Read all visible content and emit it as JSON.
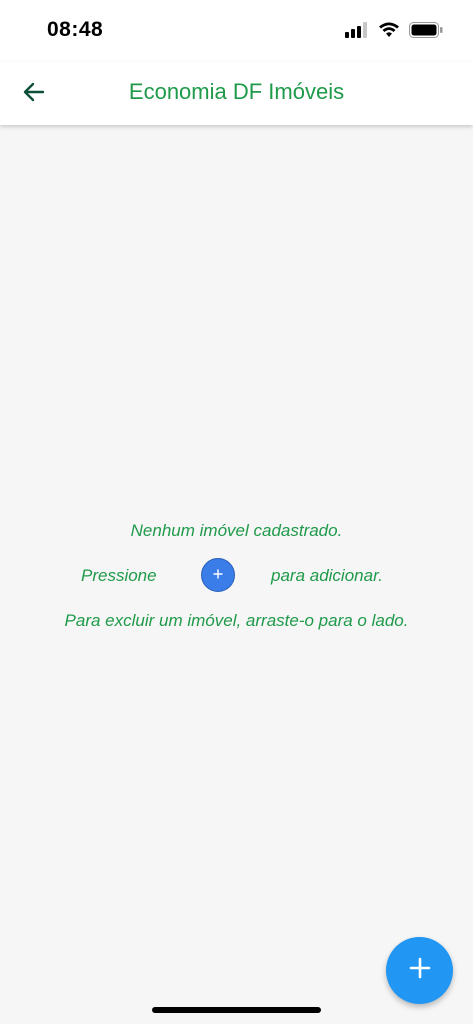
{
  "status_bar": {
    "time": "08:48",
    "icons": [
      "signal-icon",
      "wifi-icon",
      "battery-icon"
    ]
  },
  "app_bar": {
    "title": "Economia DF Imóveis",
    "back_icon": "arrow-left-icon"
  },
  "empty_state": {
    "line1": "Nenhum imóvel cadastrado.",
    "press_before": "Pressione",
    "press_after": "para adicionar.",
    "line3": "Para excluir um imóvel, arraste-o para o lado.",
    "inline_icon": "plus-icon"
  },
  "fab": {
    "icon": "plus-icon"
  },
  "colors": {
    "accent_green": "#1f9a4a",
    "fab_blue": "#2196f3",
    "inline_blue": "#3b7de8",
    "background": "#f6f6f6"
  }
}
